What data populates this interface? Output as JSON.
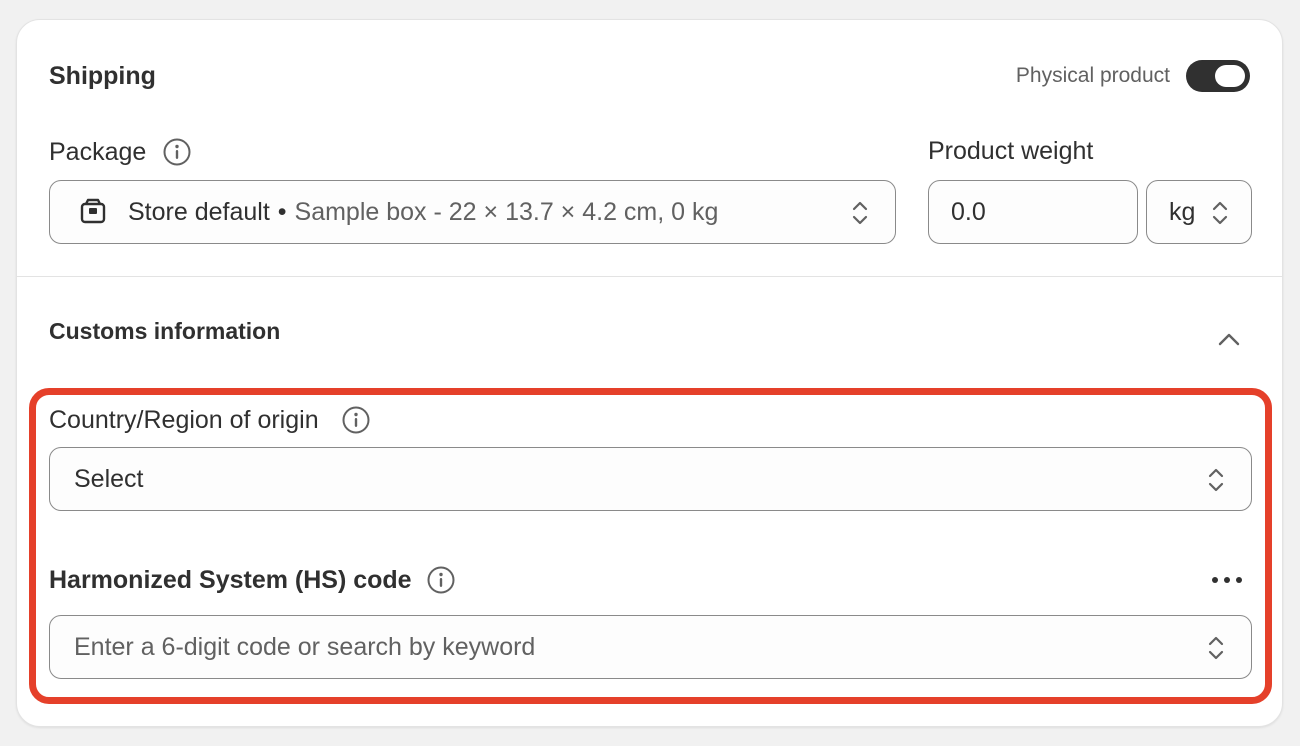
{
  "shipping": {
    "title": "Shipping",
    "physical_product_label": "Physical product",
    "physical_product_on": true
  },
  "package": {
    "label": "Package",
    "name": "Store default",
    "separator": "•",
    "details": "Sample box - 22 × 13.7 × 4.2 cm, 0 kg"
  },
  "weight": {
    "label": "Product weight",
    "value": "0.0",
    "unit": "kg"
  },
  "customs": {
    "title": "Customs information",
    "country": {
      "label": "Country/Region of origin",
      "value": "Select"
    },
    "hs_code": {
      "label": "Harmonized System (HS) code",
      "placeholder": "Enter a 6-digit code or search by keyword"
    }
  },
  "icons": {
    "info": "info-icon",
    "package": "package-icon",
    "select_arrows": "select-arrows-icon",
    "collapse": "chevron-up-icon",
    "more": "more-horizontal-icon"
  },
  "colors": {
    "toggle_on": "#303030",
    "highlight": "#e5402a",
    "border": "#8a8a8a"
  }
}
